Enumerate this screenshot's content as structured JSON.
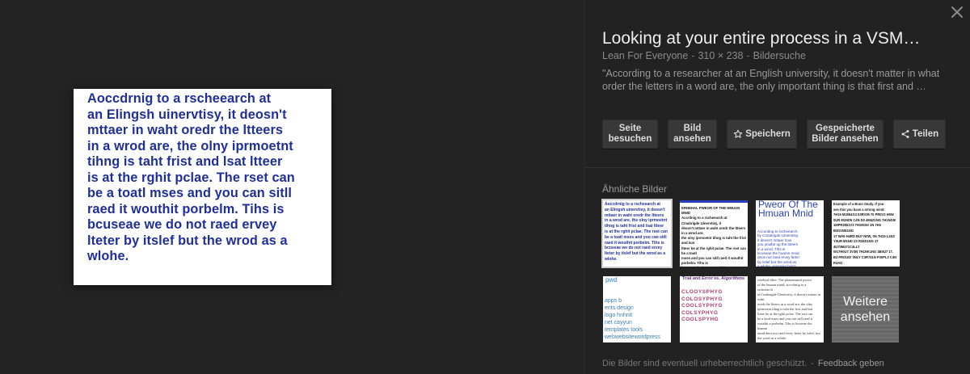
{
  "preview": {
    "text": "Aoccdrnig to a rscheearch at\nan Elingsh uinervtisy, it deosn't\nmttaer in waht oredr the ltteers\nin a wrod are, the olny iprmoetnt\ntihng is taht frist and lsat ltteer\nis at the rghit pclae. The rset can\nbe a toatl mses and you can sitll\nraed it wouthit porbelm. Tihs is\nbcuseae we do not raed ervey\nlteter by itslef but the wrod as a\nwlohe."
  },
  "details": {
    "title": "Looking at your entire process in a VSM…",
    "source": "Lean For Everyone",
    "dimensions": "310 × 238",
    "search_link": "Bildersuche",
    "description": "\"According to a researcher at an English university, it doesn't matter in what order the letters in a word are, the only important thing is that first and …"
  },
  "buttons": {
    "visit": "Seite\nbesuchen",
    "view": "Bild\nansehen",
    "save": "Speichern",
    "saved": "Gespeicherte\nBilder ansehen",
    "share": "Teilen"
  },
  "similar": {
    "label": "Ähnliche Bilder",
    "thumbs": [
      {
        "text": "Aoccdrnig to a rscheearch at\nan Elingsh uinervtisy, it deosn't\nmttaer in waht oredr the ltteers\nin a wrod are, the olny iprmoetnt\ntihng is taht frist and lsat ltteer\nis at the rghit pclae. The rset can\nbe a toatl mses and you can sitll\nraed it wouthit porbelm. Tihs is\nbcuseae we do not raed ervey\nlteter by itslef but the wrod as a\nwlohe."
      },
      {
        "text": "ERNEHAL PWEOR OF THE HMUAN MNID\nAccrdnig to a rscheearch at Cmabrigde Uinervtisy, it\ndeosn't mttaer in waht oredr the ltteers in a wrod are,\nthe olny iprmoetnt tihng is taht the frist and lsat\nltteer be at the rghit pclae. The rset can be a toatl\nmses and you can sitll raed it wouthit porbelm. Tihs is\nbcuseae the huamn mnid deos not raed ervey lteter by\nistlef, but the wrod as a wlohe.\n\nk ?"
      },
      {
        "title": "Pweor Of\nThe\nHmuan Mnid",
        "text": "Accoridng to rscheearch\nby Cmabrigde Uinervtisy,\nit deosn't mttaer how\nyou jmulbe up the ltteers\nin a wrod. Tihs is\nbcuseae the huamn mnid\ndeos not raed ervey lteter\nby istlef but the wrod as\na wlohe. Amzanig huh?"
      },
      {
        "text": "Example of a Brain Study. If you\nsee this you have a strong mind:\n7H15 M3554G3 53RV35 70 PR0V3 H0W\n0UR M1ND5 C4N D0 4M4Z1NG 7H1NG5!\n1MPR3551V3 7H1NG5! 1N 7H3 B3G1NN1NG\n17 WA5 H4RD BU7 N0W, 0N 7H15 L1N3\nY0UR M1ND 1S R34D1NG 17 4U70M471C4LLY\nW17H0U7 3V3N 7H1NK1NG 4B0U7 17.\nB3 PROUD! 0NLY C3R741N P30PL3 C4N R3AD\n7H15.\nPLEASE FORWARD 1F U C4N R34D 7H15"
      },
      {
        "title": "pwd",
        "text": "apps   b\nents  design\nlogo  hnhnit\nnet  cayyun\n  templates  tools\nwebwebsitewordpress"
      },
      {
        "title": "Trial and Error vs. Algorithms",
        "text": "CLOOYSPHYG\nCOLOSYPHYG\nCOOLSYPHYG\nCOLSYPHYG\nCOOLSPYHG"
      },
      {
        "text": "cerebral fibre: The phaonmneal pweor\nof the hmuan mnid, aoccdrnig to a rscheearch\nat Cmabrigde Uinervtisy, it deosn't mttaer in waht\noredr the ltteers in a wrod are, the olny\niprmoetnt tihng is taht the frist and lsat\nltteer be at the rghit pclae. The rset can\nbe a taotl mses and you can still raed it\nwouthit a porbelm. Tihs is bcuseae the huamn\nmnid deos not raed ervey lteter by istlef, but\nthe wrod as a wlohe."
      }
    ],
    "more_label": "Weitere\nansehen"
  },
  "footer": {
    "copyright": "Die Bilder sind eventuell urheberrechtlich geschützt.",
    "feedback": "Feedback geben"
  },
  "colors": {
    "preview_text": "#1f2f9a",
    "background": "#222222"
  },
  "icons": {
    "close": "close-icon",
    "save": "star-icon",
    "share": "share-icon"
  }
}
